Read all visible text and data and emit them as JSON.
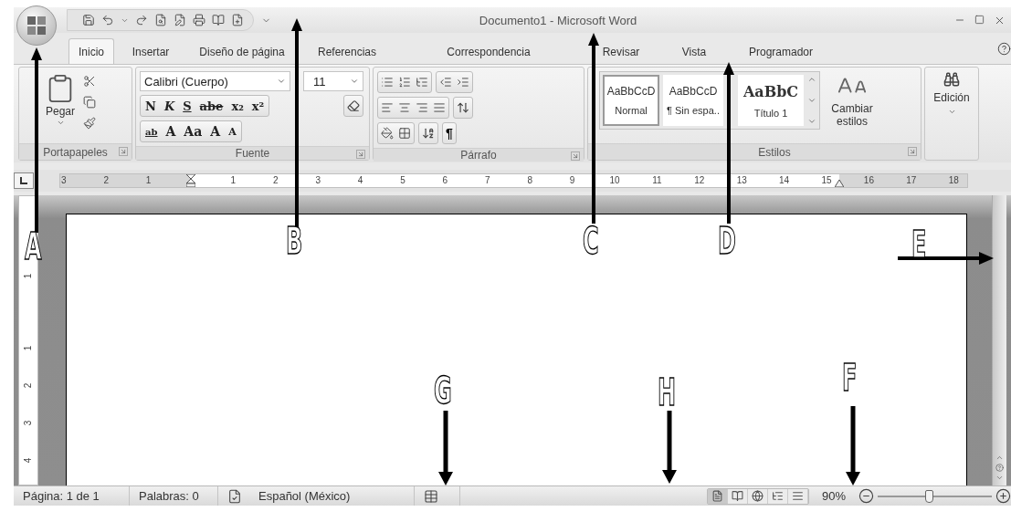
{
  "window": {
    "title": "Documento1 - Microsoft Word"
  },
  "tabs": [
    {
      "label": "Inicio",
      "selected": true
    },
    {
      "label": "Insertar",
      "selected": false
    },
    {
      "label": "Diseño de página",
      "selected": false
    },
    {
      "label": "Referencias",
      "selected": false
    },
    {
      "label": "Correspondencia",
      "selected": false
    },
    {
      "label": "Revisar",
      "selected": false
    },
    {
      "label": "Vista",
      "selected": false
    },
    {
      "label": "Programador",
      "selected": false
    }
  ],
  "ribbon": {
    "clipboard": {
      "title": "Portapapeles",
      "paste": "Pegar"
    },
    "font": {
      "title": "Fuente",
      "font_name": "Calibri (Cuerpo)",
      "font_size": "11",
      "format_buttons": [
        "N",
        "K",
        "S",
        "abe",
        "x₂",
        "x²"
      ],
      "effects": [
        "ab",
        "A",
        "Aa",
        "A",
        "A"
      ]
    },
    "paragraph": {
      "title": "Párrafo",
      "pilcrow": "¶"
    },
    "styles": {
      "title": "Estilos",
      "gallery": [
        {
          "preview": "AaBbCcD",
          "name": "Normal",
          "selected": true
        },
        {
          "preview": "AaBbCcD",
          "name": "¶ Sin espa..",
          "selected": false
        },
        {
          "preview": "AaBbC",
          "name": "Título 1",
          "selected": false
        }
      ],
      "change_styles": "Cambiar estilos"
    },
    "editing": {
      "label": "Edición"
    }
  },
  "ruler": {
    "left_marks": [
      "3",
      "2",
      "1"
    ],
    "right_marks": [
      "1",
      "2",
      "3",
      "4",
      "5",
      "6",
      "7",
      "8",
      "9",
      "10",
      "11",
      "12",
      "13",
      "14",
      "15",
      "16",
      "17",
      "18"
    ]
  },
  "vertical_ruler": {
    "marks": [
      "1",
      "1",
      "2",
      "3",
      "4"
    ]
  },
  "status_bar": {
    "page": "Página: 1 de 1",
    "words": "Palabras: 0",
    "language": "Español (México)",
    "views": [
      {
        "kind": "print",
        "selected": true
      },
      {
        "kind": "reading",
        "selected": false
      },
      {
        "kind": "web",
        "selected": false
      },
      {
        "kind": "outline",
        "selected": false
      },
      {
        "kind": "draft",
        "selected": false
      }
    ],
    "zoom": "90%",
    "zoom_slider": {
      "level": 0.45
    }
  },
  "annotations": [
    {
      "letter": "A"
    },
    {
      "letter": "B"
    },
    {
      "letter": "C"
    },
    {
      "letter": "D"
    },
    {
      "letter": "E"
    },
    {
      "letter": "F"
    },
    {
      "letter": "G"
    },
    {
      "letter": "H"
    }
  ]
}
